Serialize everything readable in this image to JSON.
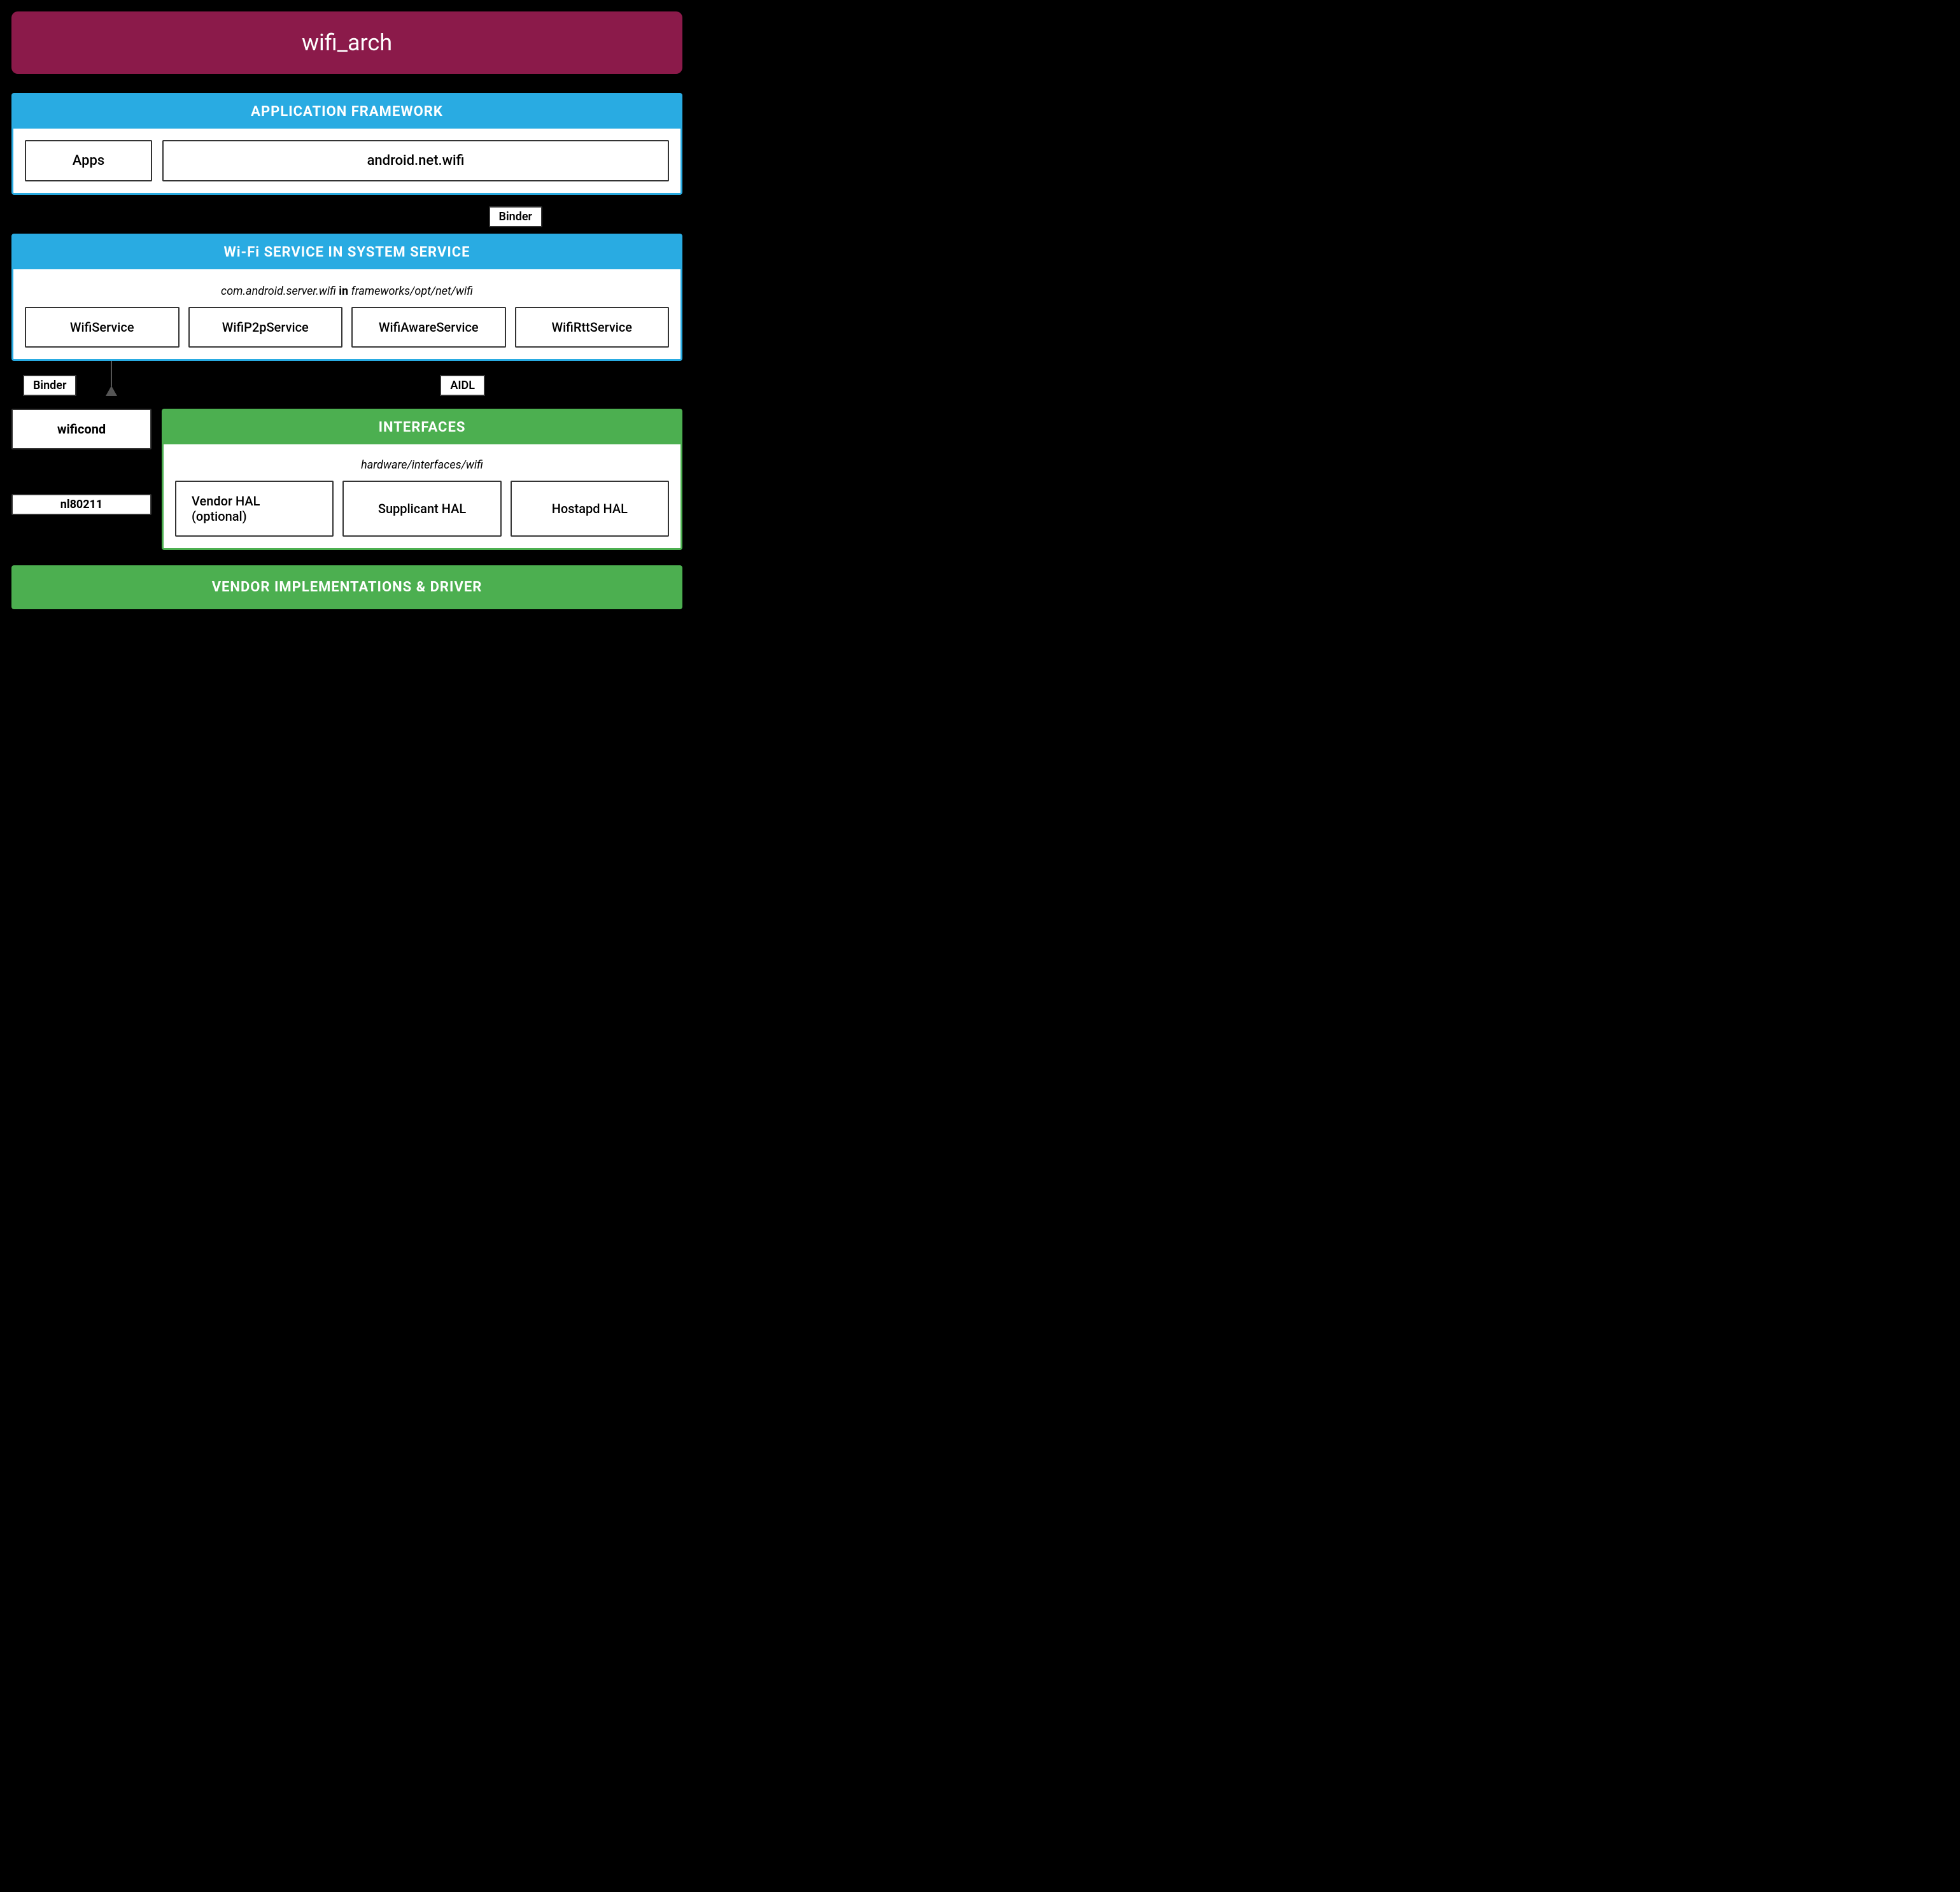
{
  "title": "wifi_arch",
  "appFramework": {
    "header": "APPLICATION FRAMEWORK",
    "apps": "Apps",
    "androidNetWifi": "android.net.wifi"
  },
  "binder1": "Binder",
  "wifiService": {
    "header": "Wi-Fi SERVICE IN SYSTEM SERVICE",
    "subtitle_italic": "com.android.server.wifi",
    "subtitle_bold": "in",
    "subtitle_path": "frameworks/opt/net/wifi",
    "services": [
      "WifiService",
      "WifiP2pService",
      "WifiAwareService",
      "WifiRttService"
    ]
  },
  "binder2": "Binder",
  "aidl": "AIDL",
  "wificond": "wificond",
  "nl80211": "nl80211",
  "interfaces": {
    "header": "INTERFACES",
    "subtitle": "hardware/interfaces/wifi",
    "hal": [
      "Vendor HAL (optional)",
      "Supplicant HAL",
      "Hostapd HAL"
    ]
  },
  "vendorImpl": "VENDOR IMPLEMENTATIONS & DRIVER"
}
